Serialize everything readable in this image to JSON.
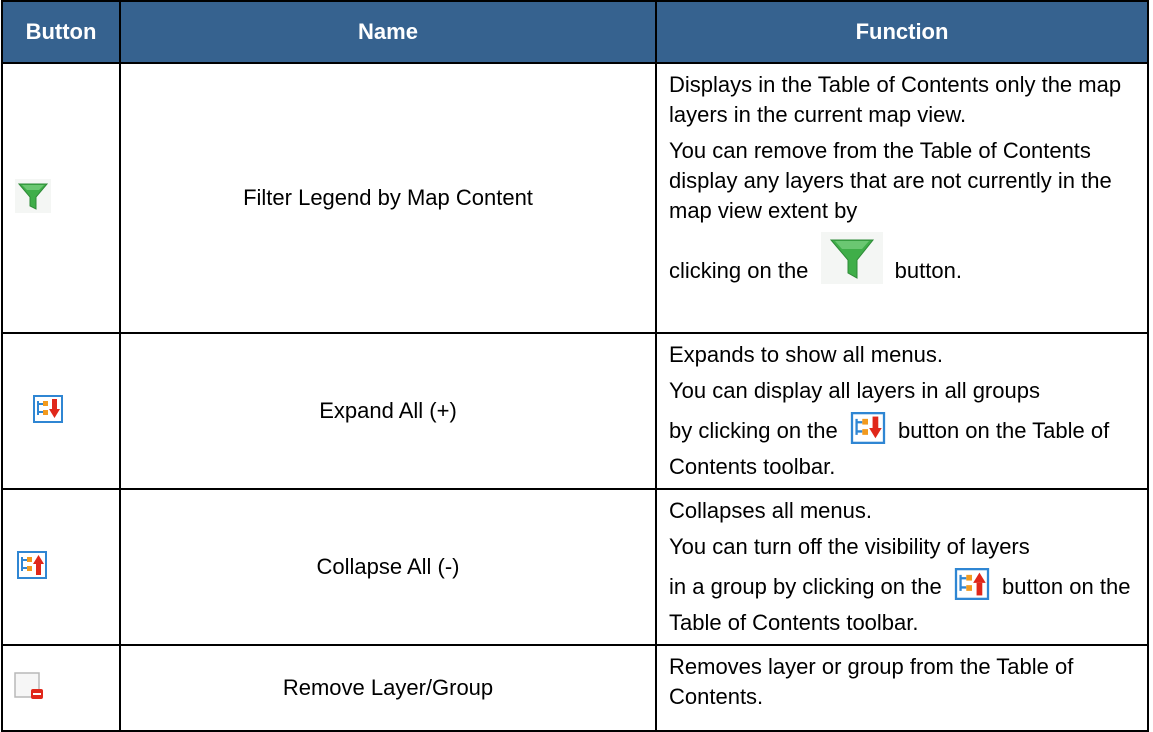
{
  "table": {
    "headers": {
      "button": "Button",
      "name": "Name",
      "function": "Function"
    },
    "rows": [
      {
        "icon": "filter-funnel-icon",
        "name": "Filter Legend by Map Content",
        "function": {
          "p1": "Displays in the Table of Contents only the map layers in the current map view.",
          "p2": "You can remove from the Table of Contents display any layers that are not currently in the map view extent by",
          "p3_before": "clicking on the",
          "p3_after": "button."
        }
      },
      {
        "icon": "expand-all-icon",
        "name": "Expand All (+)",
        "function": {
          "p1": "Expands to show all menus.",
          "p2": "You can display all layers in all groups",
          "p3_before": "by clicking on the",
          "p3_after": "button on the Table of Contents toolbar."
        }
      },
      {
        "icon": "collapse-all-icon",
        "name": "Collapse All (-)",
        "function": {
          "p1": "Collapses all menus.",
          "p2": "You can turn off the visibility of layers",
          "p3_before": "in a group by clicking on the",
          "p3_after": "button on the Table of Contents toolbar."
        }
      },
      {
        "icon": "remove-layer-icon",
        "name": "Remove Layer/Group",
        "function": {
          "p1": "Removes layer or group from the Table of Contents."
        }
      }
    ]
  },
  "colors": {
    "header_bg": "#36628f",
    "header_text": "#ffffff",
    "border": "#000000",
    "funnel_green": "#3fae49",
    "arrow_red": "#e0271a",
    "icon_blue": "#2f86d3",
    "icon_orange": "#f29a1f"
  }
}
